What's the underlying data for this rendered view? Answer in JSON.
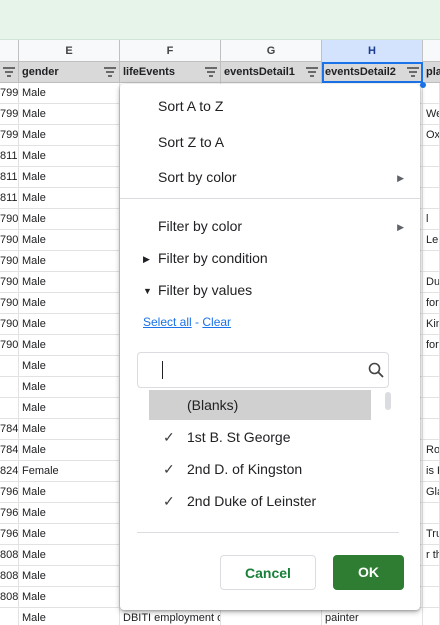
{
  "columns": [
    {
      "letter": ""
    },
    {
      "letter": "E"
    },
    {
      "letter": "F"
    },
    {
      "letter": "G"
    },
    {
      "letter": "H"
    },
    {
      "letter": ""
    }
  ],
  "headers": [
    "",
    "gender",
    "lifeEvents",
    "eventsDetail1",
    "eventsDetail2",
    "pla"
  ],
  "rows": [
    {
      "a": "799",
      "e": "Male",
      "i": ""
    },
    {
      "a": "799",
      "e": "Male",
      "i": "We"
    },
    {
      "a": "799",
      "e": "Male",
      "i": "Ox"
    },
    {
      "a": "811",
      "e": "Male",
      "i": ""
    },
    {
      "a": "811",
      "e": "Male",
      "i": ""
    },
    {
      "a": "811",
      "e": "Male",
      "i": ""
    },
    {
      "a": "790",
      "e": "Male",
      "i": "l"
    },
    {
      "a": "790",
      "e": "Male",
      "i": "Lei"
    },
    {
      "a": "790",
      "e": "Male",
      "i": ""
    },
    {
      "a": "790",
      "e": "Male",
      "i": "Du"
    },
    {
      "a": "790",
      "e": "Male",
      "i": "fore"
    },
    {
      "a": "790",
      "e": "Male",
      "i": "Kin"
    },
    {
      "a": "790",
      "e": "Male",
      "i": "fore"
    },
    {
      "a": "",
      "e": "Male",
      "i": ""
    },
    {
      "a": "",
      "e": "Male",
      "i": ""
    },
    {
      "a": "",
      "e": "Male",
      "i": ""
    },
    {
      "a": "784",
      "e": "Male",
      "i": ""
    },
    {
      "a": "784",
      "e": "Male",
      "i": "Ro"
    },
    {
      "a": "824",
      "e": "Female",
      "i": "is Pl"
    },
    {
      "a": "796",
      "e": "Male",
      "i": "Gla"
    },
    {
      "a": "796",
      "e": "Male",
      "i": ""
    },
    {
      "a": "796",
      "e": "Male",
      "i": "Tru"
    },
    {
      "a": "808",
      "e": "Male",
      "i": "r th"
    },
    {
      "a": "808",
      "e": "Male",
      "i": ""
    },
    {
      "a": "808",
      "e": "Male",
      "i": ""
    },
    {
      "a": "",
      "e": "Male",
      "f": "DBITI employment or identifier",
      "h": "painter",
      "i": ""
    }
  ],
  "menu": {
    "sort_az": "Sort A to Z",
    "sort_za": "Sort Z to A",
    "sort_color": "Sort by color",
    "filter_color": "Filter by color",
    "filter_condition": "Filter by condition",
    "filter_values": "Filter by values",
    "select_all": "Select all",
    "separator": " - ",
    "clear": "Clear",
    "search_placeholder": "",
    "values": [
      {
        "label": "(Blanks)",
        "checked": false,
        "highlighted": true
      },
      {
        "label": "1st B. St George",
        "checked": true
      },
      {
        "label": "2nd D. of Kingston",
        "checked": true
      },
      {
        "label": "2nd Duke of Leinster",
        "checked": true
      }
    ],
    "check_glyph": "✓",
    "cancel": "Cancel",
    "ok": "OK",
    "submenu_glyph": "▶",
    "collapsed_glyph": "▶",
    "expanded_glyph": "▼"
  },
  "colors": {
    "accent": "#1a73e8",
    "ok_button": "#2e7d32",
    "cancel_text": "#188038",
    "toolbar_bg": "#e6f4ea"
  }
}
